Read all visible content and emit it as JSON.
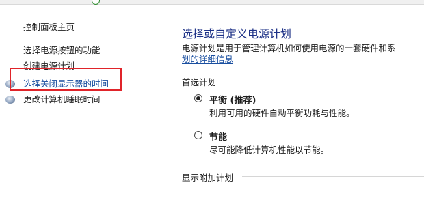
{
  "sidebar": {
    "items": [
      {
        "label": "控制面板主页"
      },
      {
        "label": "选择电源按钮的功能"
      },
      {
        "label": "创建电源计划"
      },
      {
        "label": "选择关闭显示器的时间",
        "icon": "monitor-shield-icon"
      },
      {
        "label": "更改计算机睡眠时间",
        "icon": "moon-icon"
      }
    ]
  },
  "main": {
    "title": "选择或自定义电源计划",
    "description": "电源计划是用于管理计算机如何使用电源的一套硬件和系",
    "description_link": "划的详细信息",
    "preferred_section": "首选计划",
    "plans": [
      {
        "name": "平衡 (推荐)",
        "description": "利用可用的硬件自动平衡功耗与性能。",
        "selected": true
      },
      {
        "name": "节能",
        "description": "尽可能降低计算机性能以节能。",
        "selected": false
      }
    ],
    "additional_section": "显示附加计划"
  },
  "colors": {
    "title": "#1e3287",
    "link": "#1a4fa0",
    "highlight_box": "#e0242a"
  }
}
